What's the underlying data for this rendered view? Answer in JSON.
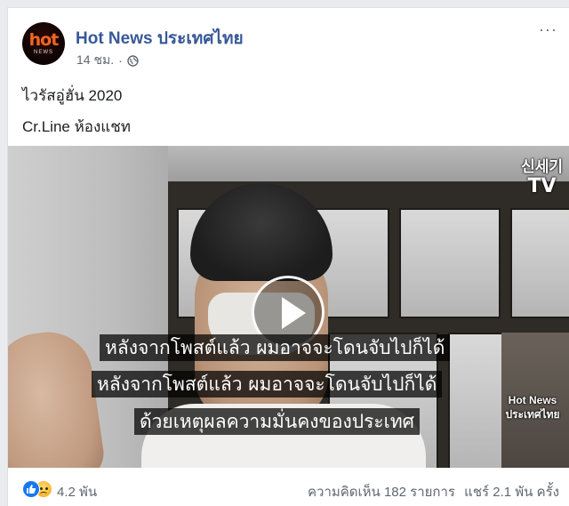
{
  "post": {
    "page_name": "Hot News ประเทศไทย",
    "time": "14 ชม.",
    "separator": "·",
    "privacy_icon": "globe-icon",
    "more_label": "···",
    "avatar": {
      "logo_text": "hot",
      "logo_subtext": "NEWS",
      "icon": "hot-news-logo"
    },
    "text_line1": "ไวรัสอู่ฮั่น 2020",
    "text_line2": "Cr.Line ห้องแชท"
  },
  "video": {
    "channel_logo_line1": "신세기",
    "channel_logo_line2": "TV",
    "watermark_line1": "Hot News",
    "watermark_line2": "ประเทศไทย",
    "subtitles": [
      "หลังจากโพสต์แล้ว  ผมอาจจะโดนจับไปก็ได้",
      "หลังจากโพสต์แล้ว  ผมอาจจะโดนจับไปก็ได้",
      "ด้วยเหตุผลความมั่นคงของประเทศ"
    ],
    "play_icon": "play-icon"
  },
  "footer": {
    "reactions": [
      "like-icon",
      "sad-icon"
    ],
    "reaction_count": "4.2 พัน",
    "comments": "ความคิดเห็น 182 รายการ",
    "shares": "แชร์ 2.1 พัน ครั้ง"
  },
  "colors": {
    "page_name": "#385898",
    "background": "#e9ebee",
    "like_blue": "#1877f2",
    "secondary_text": "#606770"
  }
}
